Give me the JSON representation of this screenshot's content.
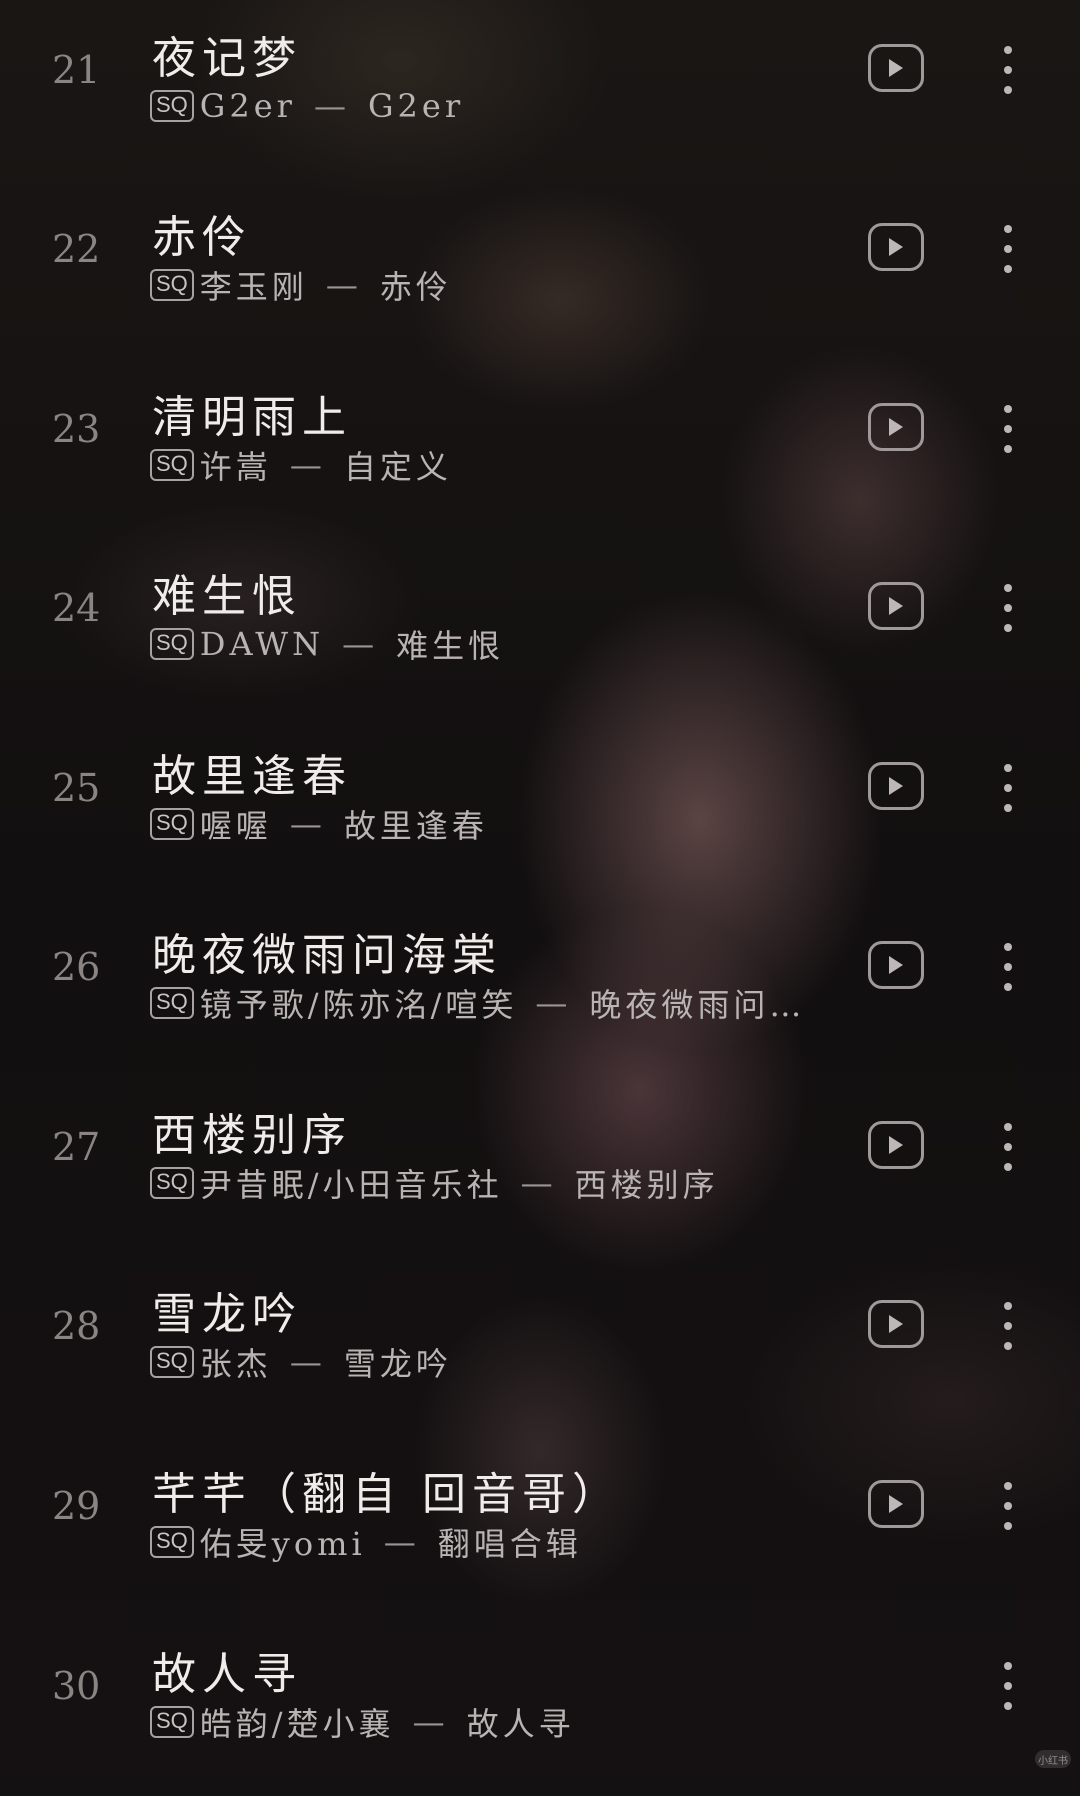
{
  "songs": [
    {
      "index": "21",
      "title": "夜记梦",
      "quality": "SQ",
      "artist": "G2er",
      "album": "G2er",
      "play_icon": "play-icon",
      "more_icon": "more-vertical-icon"
    },
    {
      "index": "22",
      "title": "赤伶",
      "quality": "SQ",
      "artist": "李玉刚",
      "album": "赤伶",
      "play_icon": "play-icon",
      "more_icon": "more-vertical-icon"
    },
    {
      "index": "23",
      "title": "清明雨上",
      "quality": "SQ",
      "artist": "许嵩",
      "album": "自定义",
      "play_icon": "play-icon",
      "more_icon": "more-vertical-icon"
    },
    {
      "index": "24",
      "title": "难生恨",
      "quality": "SQ",
      "artist": "DAWN",
      "album": "难生恨",
      "play_icon": "play-icon",
      "more_icon": "more-vertical-icon"
    },
    {
      "index": "25",
      "title": "故里逢春",
      "quality": "SQ",
      "artist": "喔喔",
      "album": "故里逢春",
      "play_icon": "play-icon",
      "more_icon": "more-vertical-icon"
    },
    {
      "index": "26",
      "title": "晚夜微雨问海棠",
      "quality": "SQ",
      "artist": "镜予歌/陈亦洺/喧笑",
      "album": "晚夜微雨问…",
      "play_icon": "play-icon",
      "more_icon": "more-vertical-icon"
    },
    {
      "index": "27",
      "title": "西楼别序",
      "quality": "SQ",
      "artist": "尹昔眠/小田音乐社",
      "album": "西楼别序",
      "play_icon": "play-icon",
      "more_icon": "more-vertical-icon"
    },
    {
      "index": "28",
      "title": "雪龙吟",
      "quality": "SQ",
      "artist": "张杰",
      "album": "雪龙吟",
      "play_icon": "play-icon",
      "more_icon": "more-vertical-icon"
    },
    {
      "index": "29",
      "title": "芊芊（翻自 回音哥）",
      "quality": "SQ",
      "artist": "佑旻yomi",
      "album": "翻唱合辑",
      "play_icon": "play-icon",
      "more_icon": "more-vertical-icon"
    },
    {
      "index": "30",
      "title": "故人寻",
      "quality": "SQ",
      "artist": "皓韵/楚小襄",
      "album": "故人寻",
      "more_icon": "more-vertical-icon"
    }
  ],
  "separator": "—",
  "watermark": "小红书"
}
